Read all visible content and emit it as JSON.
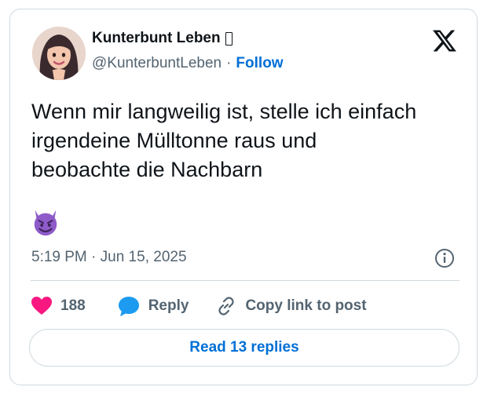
{
  "author": {
    "display_name": "Kunterbunt Leben",
    "handle": "@KunterbuntLeben",
    "separator": "·",
    "follow_label": "Follow"
  },
  "brand": {
    "icon": "x-logo-icon",
    "color": "#0f1419"
  },
  "tweet": {
    "text": "Wenn mir langweilig ist, stelle ich einfach\nirgendeine Mülltonne raus und\nbeobachte die Nachbarn",
    "emoji": "smiling-imp-emoji",
    "timestamp": "5:19 PM · Jun 15, 2025"
  },
  "actions": {
    "like_count": "188",
    "reply_label": "Reply",
    "copy_label": "Copy link to post"
  },
  "read_replies_label": "Read 13 replies",
  "colors": {
    "accent": "#006fd6",
    "heart": "#f91880",
    "reply_bubble": "#1d9bf0",
    "secondary_text": "#536471",
    "border": "#cfd9de",
    "emoji_purple": "#8e5bc9"
  }
}
